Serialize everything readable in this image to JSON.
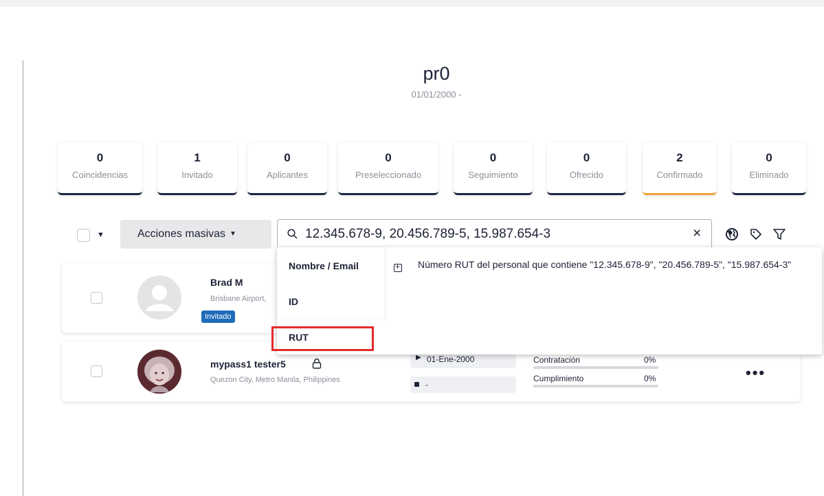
{
  "page": {
    "title": "pr0",
    "subtitle": "01/01/2000 -"
  },
  "stages": [
    {
      "count": "0",
      "label": "Coincidencias",
      "active": false
    },
    {
      "count": "1",
      "label": "Invitado",
      "active": false
    },
    {
      "count": "0",
      "label": "Aplicantes",
      "active": false
    },
    {
      "count": "0",
      "label": "Preseleccionado",
      "active": false
    },
    {
      "count": "0",
      "label": "Seguimiento",
      "active": false
    },
    {
      "count": "0",
      "label": "Ofrecido",
      "active": false
    },
    {
      "count": "2",
      "label": "Confirmado",
      "active": true
    },
    {
      "count": "0",
      "label": "Eliminado",
      "active": false
    }
  ],
  "toolbar": {
    "bulk_actions_label": "Acciones masivas",
    "search_value": "12.345.678-9, 20.456.789-5, 15.987.654-3",
    "clear_symbol": "×"
  },
  "dropdown": {
    "options": [
      "Nombre / Email",
      "ID",
      "RUT"
    ],
    "highlighted": "RUT",
    "description": "Número RUT del personal que contiene \"12.345.678-9\", \"20.456.789-5\", \"15.987.654-3\""
  },
  "candidates": [
    {
      "name": "Brad M",
      "location": "Brisbane Airport, ",
      "badge": "Invitado"
    },
    {
      "name": "mypass1 tester5",
      "location": "Quezon City, Metro Manila, Philippines",
      "start_date": "01-Ene-2000",
      "end_date": "-",
      "metrics": [
        {
          "label": "Contratación",
          "value": "0%"
        },
        {
          "label": "Cumplimiento",
          "value": "0%"
        }
      ],
      "more": "•••"
    }
  ],
  "colors": {
    "accent_active": "#f2a33a",
    "stage_border": "#1d2742",
    "badge": "#1e6bb8",
    "highlight_box": "#e32a2a"
  }
}
